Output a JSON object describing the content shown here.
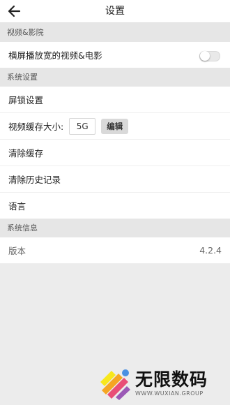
{
  "header": {
    "title": "设置",
    "back_icon": "back-arrow-icon"
  },
  "video_section": {
    "title": "视频&影院",
    "landscape_label": "横屏播放宽的视频&电影",
    "landscape_enabled": false
  },
  "system_section": {
    "title": "系统设置",
    "lock_label": "屏锁设置",
    "cache_label": "视频缓存大小:",
    "cache_value": "5G",
    "edit_label": "编辑",
    "clear_cache_label": "清除缓存",
    "clear_history_label": "清除历史记录",
    "language_label": "语言"
  },
  "info_section": {
    "title": "系统信息",
    "version_label": "版本",
    "version_value": "4.2.4"
  },
  "watermark": {
    "name": "无限数码",
    "url": "WWW.WUXIAN.GROUP"
  }
}
